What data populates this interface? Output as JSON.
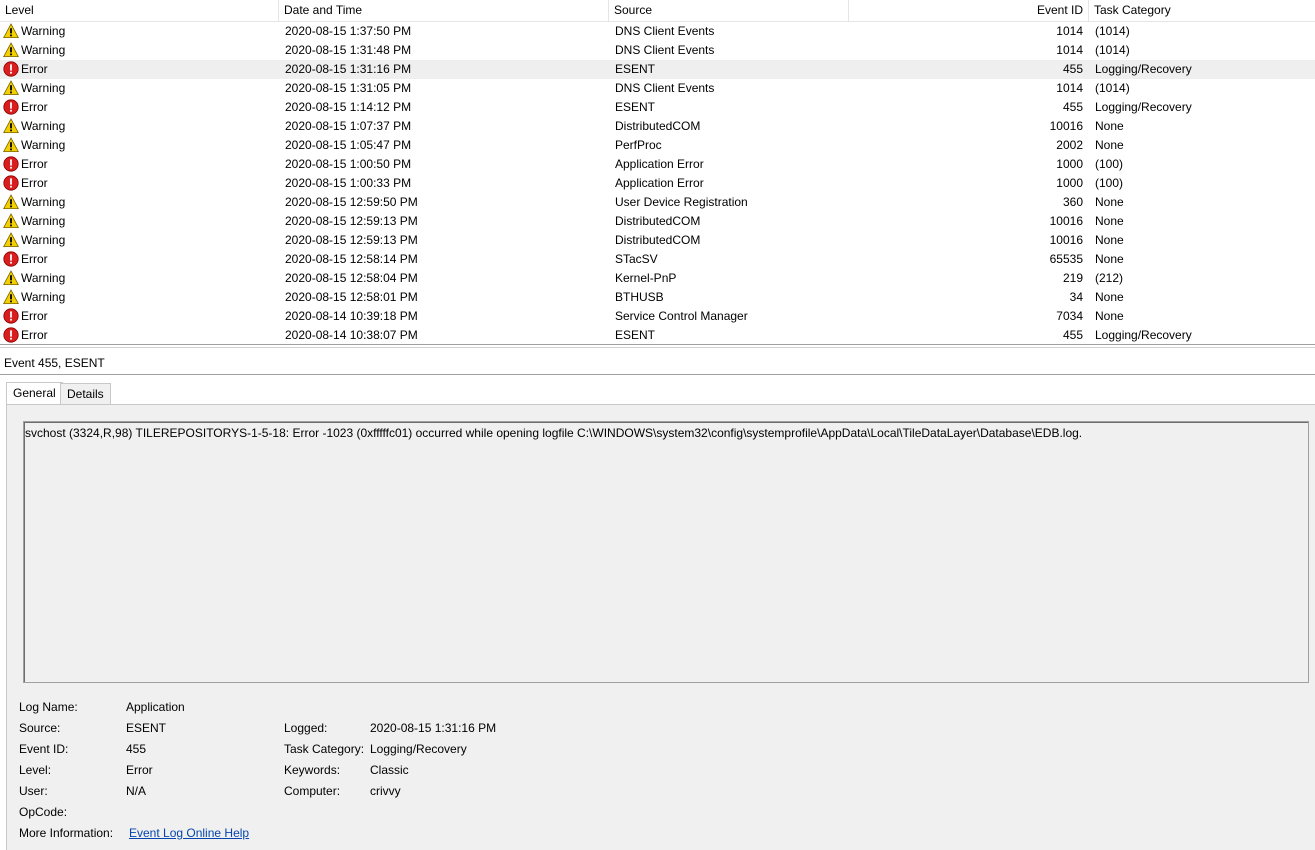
{
  "columns": {
    "level": "Level",
    "date": "Date and Time",
    "source": "Source",
    "event_id": "Event ID",
    "task_category": "Task Category"
  },
  "events": [
    {
      "level": "Warning",
      "date": "2020-08-15 1:37:50 PM",
      "source": "DNS Client Events",
      "event_id": "1014",
      "task_category": "(1014)",
      "icon": "warning-icon",
      "selected": false
    },
    {
      "level": "Warning",
      "date": "2020-08-15 1:31:48 PM",
      "source": "DNS Client Events",
      "event_id": "1014",
      "task_category": "(1014)",
      "icon": "warning-icon",
      "selected": false
    },
    {
      "level": "Error",
      "date": "2020-08-15 1:31:16 PM",
      "source": "ESENT",
      "event_id": "455",
      "task_category": "Logging/Recovery",
      "icon": "error-icon",
      "selected": true
    },
    {
      "level": "Warning",
      "date": "2020-08-15 1:31:05 PM",
      "source": "DNS Client Events",
      "event_id": "1014",
      "task_category": "(1014)",
      "icon": "warning-icon",
      "selected": false
    },
    {
      "level": "Error",
      "date": "2020-08-15 1:14:12 PM",
      "source": "ESENT",
      "event_id": "455",
      "task_category": "Logging/Recovery",
      "icon": "error-icon",
      "selected": false
    },
    {
      "level": "Warning",
      "date": "2020-08-15 1:07:37 PM",
      "source": "DistributedCOM",
      "event_id": "10016",
      "task_category": "None",
      "icon": "warning-icon",
      "selected": false
    },
    {
      "level": "Warning",
      "date": "2020-08-15 1:05:47 PM",
      "source": "PerfProc",
      "event_id": "2002",
      "task_category": "None",
      "icon": "warning-icon",
      "selected": false
    },
    {
      "level": "Error",
      "date": "2020-08-15 1:00:50 PM",
      "source": "Application Error",
      "event_id": "1000",
      "task_category": "(100)",
      "icon": "error-icon",
      "selected": false
    },
    {
      "level": "Error",
      "date": "2020-08-15 1:00:33 PM",
      "source": "Application Error",
      "event_id": "1000",
      "task_category": "(100)",
      "icon": "error-icon",
      "selected": false
    },
    {
      "level": "Warning",
      "date": "2020-08-15 12:59:50 PM",
      "source": "User Device Registration",
      "event_id": "360",
      "task_category": "None",
      "icon": "warning-icon",
      "selected": false
    },
    {
      "level": "Warning",
      "date": "2020-08-15 12:59:13 PM",
      "source": "DistributedCOM",
      "event_id": "10016",
      "task_category": "None",
      "icon": "warning-icon",
      "selected": false
    },
    {
      "level": "Warning",
      "date": "2020-08-15 12:59:13 PM",
      "source": "DistributedCOM",
      "event_id": "10016",
      "task_category": "None",
      "icon": "warning-icon",
      "selected": false
    },
    {
      "level": "Error",
      "date": "2020-08-15 12:58:14 PM",
      "source": "STacSV",
      "event_id": "65535",
      "task_category": "None",
      "icon": "error-icon",
      "selected": false
    },
    {
      "level": "Warning",
      "date": "2020-08-15 12:58:04 PM",
      "source": "Kernel-PnP",
      "event_id": "219",
      "task_category": "(212)",
      "icon": "warning-icon",
      "selected": false
    },
    {
      "level": "Warning",
      "date": "2020-08-15 12:58:01 PM",
      "source": "BTHUSB",
      "event_id": "34",
      "task_category": "None",
      "icon": "warning-icon",
      "selected": false
    },
    {
      "level": "Error",
      "date": "2020-08-14 10:39:18 PM",
      "source": "Service Control Manager",
      "event_id": "7034",
      "task_category": "None",
      "icon": "error-icon",
      "selected": false
    },
    {
      "level": "Error",
      "date": "2020-08-14 10:38:07 PM",
      "source": "ESENT",
      "event_id": "455",
      "task_category": "Logging/Recovery",
      "icon": "error-icon",
      "selected": false
    }
  ],
  "detail": {
    "title": "Event 455, ESENT",
    "tabs": [
      "General",
      "Details"
    ],
    "active_tab": "General",
    "message": "svchost (3324,R,98) TILEREPOSITORYS-1-5-18: Error -1023 (0xfffffc01) occurred while opening logfile C:\\WINDOWS\\system32\\config\\systemprofile\\AppData\\Local\\TileDataLayer\\Database\\EDB.log.",
    "props": {
      "log_name_label": "Log Name:",
      "log_name": "Application",
      "source_label": "Source:",
      "source": "ESENT",
      "event_id_label": "Event ID:",
      "event_id": "455",
      "level_label": "Level:",
      "level": "Error",
      "user_label": "User:",
      "user": "N/A",
      "opcode_label": "OpCode:",
      "opcode": "",
      "more_info_label": "More Information:",
      "more_info_link": "Event Log Online Help",
      "logged_label": "Logged:",
      "logged": "2020-08-15 1:31:16 PM",
      "task_category_label": "Task Category:",
      "task_category": "Logging/Recovery",
      "keywords_label": "Keywords:",
      "keywords": "Classic",
      "computer_label": "Computer:",
      "computer": "crivvy"
    }
  },
  "colors": {
    "selected_row": "#efefef",
    "warning_fill": "#f5d000",
    "error_fill": "#d81e1e",
    "link": "#0645ad"
  }
}
